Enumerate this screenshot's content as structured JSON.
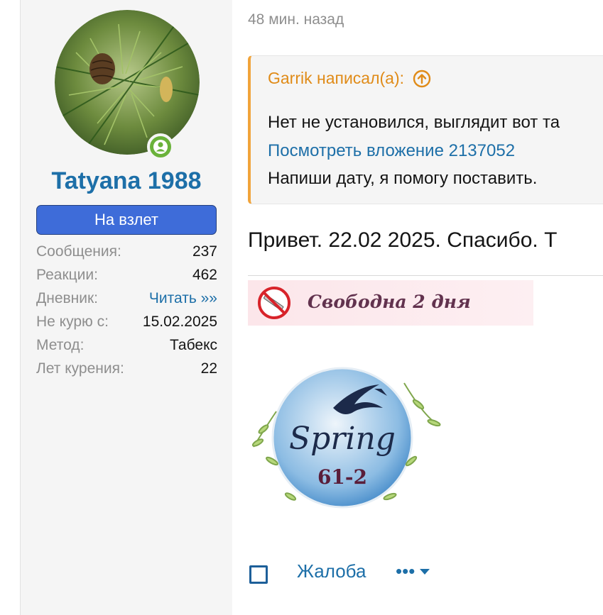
{
  "user": {
    "name": "Tatyana 1988",
    "rank": "На взлет",
    "stats": [
      {
        "label": "Сообщения:",
        "value": "237",
        "link": false
      },
      {
        "label": "Реакции:",
        "value": "462",
        "link": false
      },
      {
        "label": "Дневник:",
        "value": "Читать »»",
        "link": true
      },
      {
        "label": "Не курю с:",
        "value": "15.02.2025",
        "link": false
      },
      {
        "label": "Метод:",
        "value": "Табекс",
        "link": false
      },
      {
        "label": "Лет курения:",
        "value": "22",
        "link": false
      }
    ]
  },
  "post": {
    "time": "48 мин. назад",
    "quote": {
      "author": "Garrik написал(а):",
      "line1": "Нет не установился, выглядит вот та",
      "attachment_link": "Посмотреть вложение 2137052",
      "line3": "Напиши дату, я помогу поставить."
    },
    "reply": "Привет. 22.02 2025. Спасибо. Т",
    "signature": {
      "free_banner": "Свободна 2 дня",
      "spring_title": "Spring",
      "spring_number": "61-2"
    },
    "actions": {
      "report": "Жалоба",
      "more": "•••"
    }
  },
  "colors": {
    "accent": "#1d6fa8",
    "quote_border": "#f1a43b",
    "rank_bg": "#3e6cd9",
    "online": "#6ab23a"
  },
  "icons": [
    "online-user-icon",
    "arrow-up-circle-icon",
    "no-smoking-icon",
    "caret-down-icon"
  ]
}
